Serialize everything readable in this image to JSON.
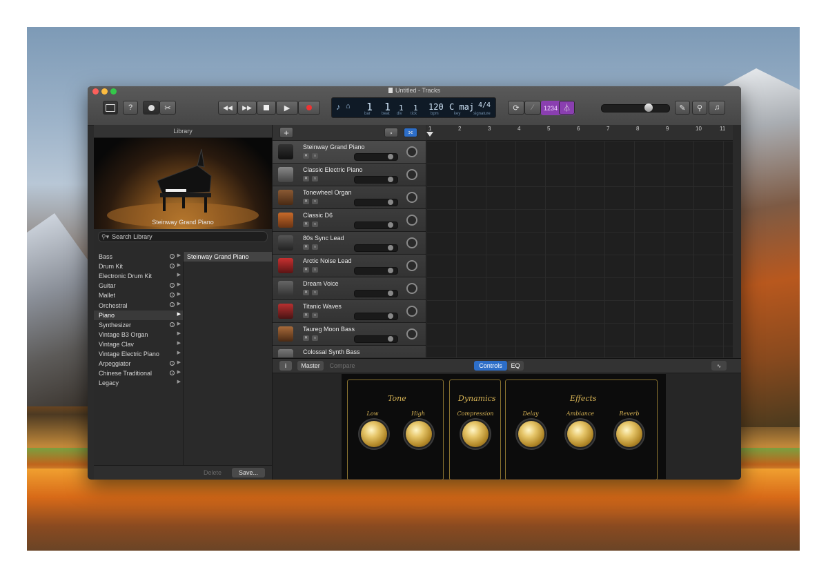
{
  "window": {
    "title": "Untitled - Tracks"
  },
  "lcd": {
    "bar": "1",
    "beat": "1",
    "div": "1",
    "tick": "1",
    "bar_label": "bar",
    "beat_label": "beat",
    "div_label": "div",
    "tick_label": "tick",
    "tempo": "120",
    "tempo_label": "bpm",
    "key": "C maj",
    "key_label": "key",
    "signature": "4/4",
    "signature_label": "signature"
  },
  "count_in": "1234",
  "library": {
    "header": "Library",
    "selected_patch_caption": "Steinway Grand Piano",
    "search_placeholder": "Search Library",
    "categories": [
      "Bass",
      "Drum Kit",
      "Electronic Drum Kit",
      "Guitar",
      "Mallet",
      "Orchestral",
      "Piano",
      "Synthesizer",
      "Vintage B3 Organ",
      "Vintage Clav",
      "Vintage Electric Piano",
      "Arpeggiator",
      "Chinese Traditional",
      "Legacy"
    ],
    "selected_category": "Piano",
    "patches": [
      "Steinway Grand Piano"
    ],
    "delete_label": "Delete",
    "save_label": "Save..."
  },
  "tracks": [
    {
      "name": "Steinway Grand Piano"
    },
    {
      "name": "Classic Electric Piano"
    },
    {
      "name": "Tonewheel Organ"
    },
    {
      "name": "Classic D6"
    },
    {
      "name": "80s Sync Lead"
    },
    {
      "name": "Arctic Noise Lead"
    },
    {
      "name": "Dream Voice"
    },
    {
      "name": "Titanic Waves"
    },
    {
      "name": "Taureg Moon Bass"
    },
    {
      "name": "Colossal Synth Bass"
    }
  ],
  "ruler": {
    "bars": [
      "1",
      "2",
      "3",
      "4",
      "5",
      "6",
      "7",
      "8",
      "9",
      "10",
      "11"
    ]
  },
  "smart_controls": {
    "master_label": "Master",
    "compare_label": "Compare",
    "controls_tab": "Controls",
    "eq_tab": "EQ",
    "sections": {
      "tone": {
        "title": "Tone",
        "knobs": [
          "Low",
          "High"
        ]
      },
      "dynamics": {
        "title": "Dynamics",
        "knobs": [
          "Compression"
        ]
      },
      "effects": {
        "title": "Effects",
        "knobs": [
          "Delay",
          "Ambiance",
          "Reverb"
        ]
      }
    }
  },
  "colors": {
    "accent_blue": "#2d6ec8",
    "count_in_purple": "#8a3fb0",
    "gold": "#d8b455"
  }
}
